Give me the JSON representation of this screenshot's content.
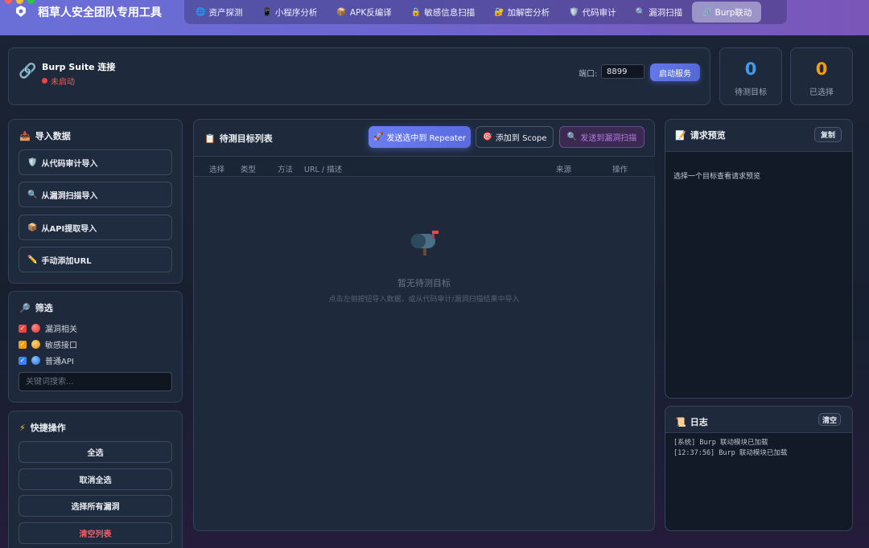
{
  "app": {
    "title": "稻草人安全团队专用工具"
  },
  "nav": {
    "tabs": [
      {
        "icon": "🌐",
        "label": "资产探测"
      },
      {
        "icon": "📱",
        "label": "小程序分析"
      },
      {
        "icon": "📦",
        "label": "APK反编译"
      },
      {
        "icon": "🔒",
        "label": "敏感信息扫描"
      },
      {
        "icon": "🔐",
        "label": "加解密分析"
      },
      {
        "icon": "🛡️",
        "label": "代码审计"
      },
      {
        "icon": "🔍",
        "label": "漏洞扫描"
      },
      {
        "icon": "🔗",
        "label": "Burp联动"
      }
    ],
    "active_index": 7
  },
  "connection": {
    "title": "Burp Suite 连接",
    "status": "未启动",
    "port_label": "端口:",
    "port_value": "8899",
    "start_button": "启动服务"
  },
  "stats": {
    "pending": {
      "value": "0",
      "label": "待测目标",
      "color": "#3b9cf0"
    },
    "selected": {
      "value": "0",
      "label": "已选择",
      "color": "#f59e0b"
    }
  },
  "import": {
    "title": "导入数据",
    "buttons": [
      {
        "icon": "🛡️",
        "label": "从代码审计导入"
      },
      {
        "icon": "🔍",
        "label": "从漏洞扫描导入"
      },
      {
        "icon": "📦",
        "label": "从API提取导入"
      },
      {
        "icon": "✏️",
        "label": "手动添加URL"
      }
    ]
  },
  "filter": {
    "title": "筛选",
    "items": [
      {
        "label": "漏洞相关",
        "checked": true,
        "box_color": "#ef4444",
        "dot_color": "#e5484d"
      },
      {
        "label": "敏感接口",
        "checked": true,
        "box_color": "#f59e0b",
        "dot_color": "#f59e0b"
      },
      {
        "label": "普通API",
        "checked": true,
        "box_color": "#3b82f6",
        "dot_color": "#3b82f6"
      }
    ],
    "search_placeholder": "关键词搜索..."
  },
  "quick": {
    "title": "快捷操作",
    "buttons": [
      "全选",
      "取消全选",
      "选择所有漏洞",
      "清空列表"
    ]
  },
  "targets": {
    "title": "待测目标列表",
    "send_repeater": "发送选中到 Repeater",
    "add_scope": "添加到 Scope",
    "send_scan": "发送到漏洞扫描",
    "columns": [
      "选择",
      "类型",
      "方法",
      "URL / 描述",
      "来源",
      "操作"
    ],
    "empty_title": "暂无待测目标",
    "empty_hint": "点击左侧按钮导入数据，或从代码审计/漏洞扫描结果中导入"
  },
  "preview": {
    "title": "请求预览",
    "copy_button": "复制",
    "placeholder": "选择一个目标查看请求预览"
  },
  "log": {
    "title": "日志",
    "clear_button": "清空",
    "lines": [
      "[系统] Burp 联动模块已加载",
      "[12:37:56] Burp 联动模块已加载"
    ]
  },
  "colors": {
    "accent": "#5b6ee1",
    "danger": "#ef4444"
  }
}
